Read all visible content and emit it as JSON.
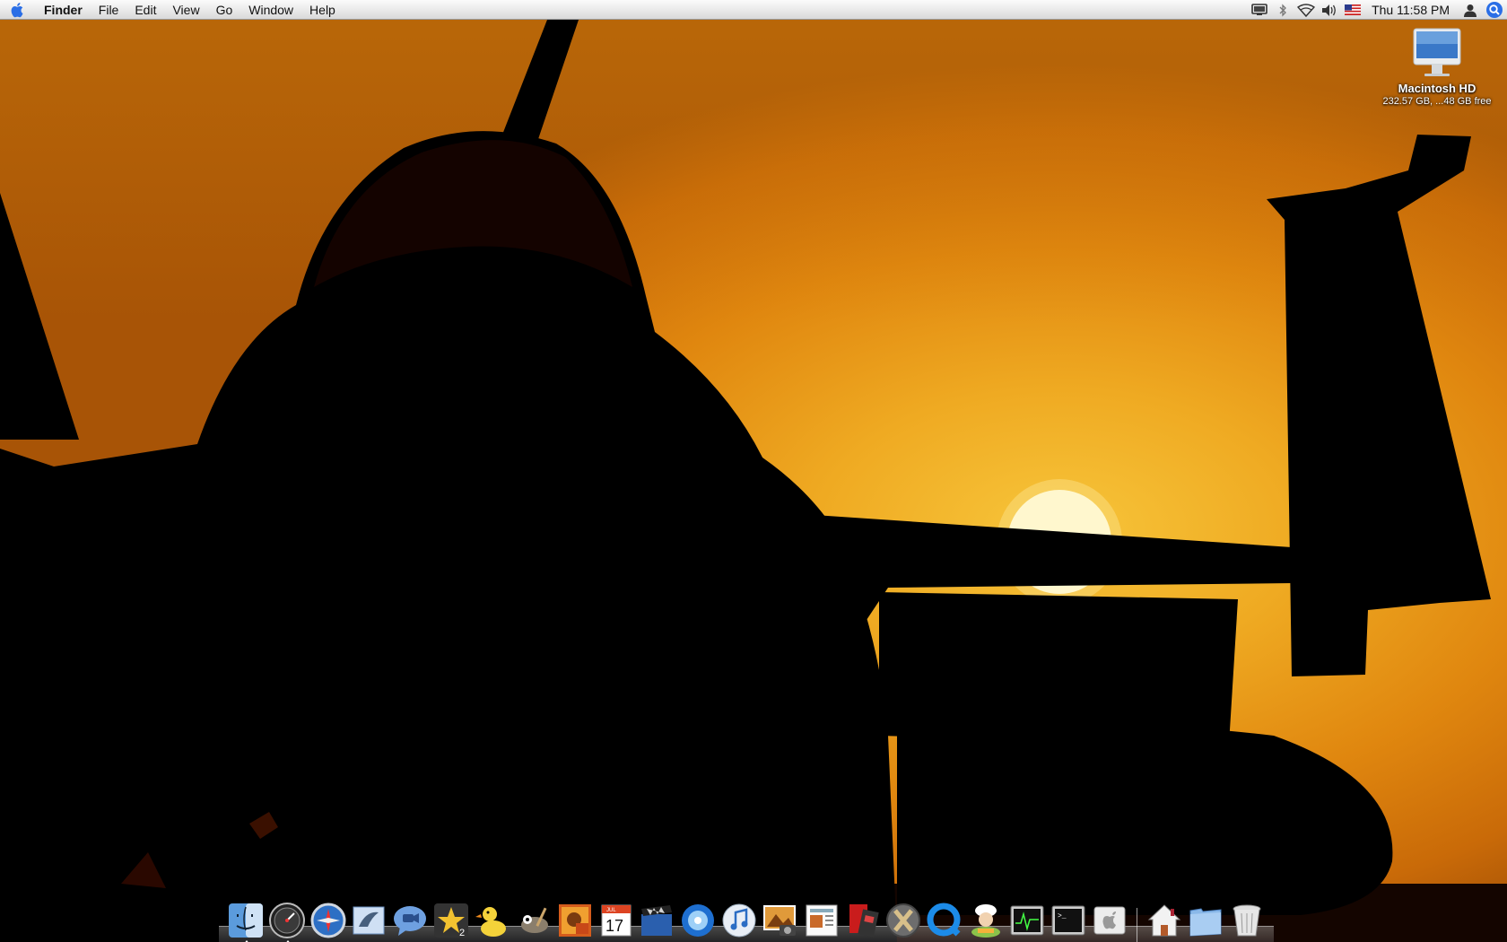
{
  "menubar": {
    "apple_icon": "apple-logo-icon",
    "items": [
      {
        "label": "Finder",
        "bold": true
      },
      {
        "label": "File"
      },
      {
        "label": "Edit"
      },
      {
        "label": "View"
      },
      {
        "label": "Go"
      },
      {
        "label": "Window"
      },
      {
        "label": "Help"
      }
    ],
    "status_icons": [
      "display-mirroring-icon",
      "bluetooth-icon",
      "wifi-icon",
      "volume-icon",
      "us-flag-input-icon"
    ],
    "clock": "Thu 11:58 PM",
    "user_icon": "user-icon",
    "spotlight_icon": "spotlight-icon"
  },
  "desktop": {
    "disk": {
      "name": "Macintosh HD",
      "info": "232.57 GB, ...48 GB free",
      "icon": "imac-hard-drive-icon"
    },
    "wallpaper": "jet-silhouette-sunset",
    "colors": {
      "sky": "#e89a18",
      "sun": "#fff6c8",
      "silhouette": "#000000"
    }
  },
  "dock": {
    "apps": [
      {
        "name": "finder",
        "icon": "finder-icon",
        "running": true
      },
      {
        "name": "dashboard",
        "icon": "dashboard-icon",
        "running": true
      },
      {
        "name": "safari",
        "icon": "safari-icon"
      },
      {
        "name": "mail",
        "icon": "mail-icon"
      },
      {
        "name": "ichat",
        "icon": "ichat-icon"
      },
      {
        "name": "star-app",
        "icon": "star-icon"
      },
      {
        "name": "cyberduck",
        "icon": "duck-icon"
      },
      {
        "name": "gimp",
        "icon": "gimp-icon"
      },
      {
        "name": "photo-booth",
        "icon": "photo-booth-icon"
      },
      {
        "name": "ical",
        "icon": "calendar-icon",
        "date": "17",
        "month": "JUL"
      },
      {
        "name": "imovie",
        "icon": "clapper-icon"
      },
      {
        "name": "idvd",
        "icon": "dvd-icon"
      },
      {
        "name": "itunes",
        "icon": "itunes-icon"
      },
      {
        "name": "iphoto",
        "icon": "iphoto-icon"
      },
      {
        "name": "preview",
        "icon": "preview-icon"
      },
      {
        "name": "flick",
        "icon": "film-strip-icon"
      },
      {
        "name": "x11",
        "icon": "x11-icon"
      },
      {
        "name": "quicktime",
        "icon": "quicktime-icon"
      },
      {
        "name": "chef",
        "icon": "chef-icon"
      },
      {
        "name": "activity-monitor",
        "icon": "activity-monitor-icon"
      },
      {
        "name": "terminal",
        "icon": "terminal-icon"
      },
      {
        "name": "system-preferences",
        "icon": "apple-prefs-icon"
      }
    ],
    "docs": [
      {
        "name": "home",
        "icon": "home-folder-icon"
      },
      {
        "name": "documents",
        "icon": "folder-icon"
      },
      {
        "name": "trash",
        "icon": "trash-icon"
      }
    ]
  }
}
